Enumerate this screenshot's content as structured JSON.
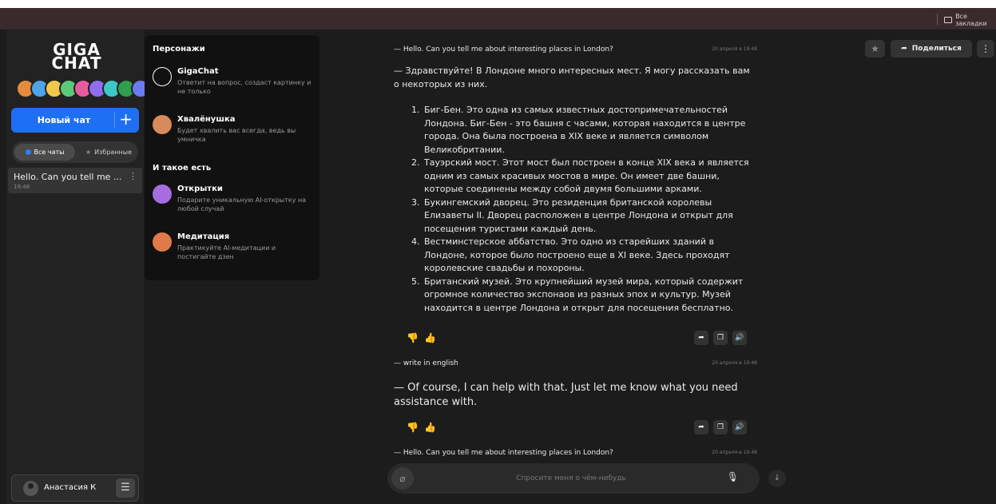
{
  "browser": {
    "bookmarks_label": "Все закладки"
  },
  "sidebar": {
    "logo_line1": "GIGA",
    "logo_line2": "CHAT",
    "new_chat_label": "Новый чат",
    "plus_symbol": "+",
    "filters": {
      "all": "Все чаты",
      "favorites": "Избранные"
    },
    "chats": [
      {
        "title": "Hello. Can you tell me ...",
        "time": "19:48",
        "menu": "⋮"
      }
    ],
    "user": {
      "name": "Анастасия К",
      "menu_icon": "☰"
    }
  },
  "characters": {
    "section1": "Персонажи",
    "section2": "И такое есть",
    "items": [
      {
        "name": "GigaChat",
        "desc": "Ответит на вопрос, создаст картинку и не только",
        "icon": "gigachat-logo-icon",
        "color": "#111111"
      },
      {
        "name": "Хвалёнушка",
        "desc": "Будет хвалить вас всегда, ведь вы умничка",
        "icon": "hvalenushka-avatar-icon",
        "color": "#d98a5c"
      },
      {
        "name": "Открытки",
        "desc": "Подарите уникальную AI-открытку на любой случай",
        "icon": "postcard-star-icon",
        "color": "#a56de0"
      },
      {
        "name": "Медитация",
        "desc": "Практикуйте AI-медитации и постигайте дзен",
        "icon": "meditation-star-icon",
        "color": "#e07a4a"
      }
    ]
  },
  "conversation": {
    "user_q1": "— Hello. Can you tell me about interesting places in London?",
    "user_q1_time": "20 апреля в 19:48",
    "answer1_intro": "— Здравствуйте! В Лондоне много интересных мест. Я могу рассказать вам о некоторых из них.",
    "answer1_items": [
      "Биг-Бен. Это одна из самых известных достопримечательностей Лондона. Биг-Бен - это башня с часами, которая находится в центре города. Она была построена в XIX веке и является символом Великобритании.",
      "Тауэрский мост. Этот мост был построен в конце XIX века и является одним из самых красивых мостов в мире. Он имеет две башни, которые соединены между собой двумя большими арками.",
      "Букингемский дворец. Это резиденция британской королевы Елизаветы II. Дворец расположен в центре Лондона и открыт для посещения туристами каждый день.",
      "Вестминстерское аббатство. Это одно из старейших зданий в Лондоне, которое было построено еще в XI веке. Здесь проходят королевские свадьбы и похороны.",
      "Британский музей. Это крупнейший музей мира, который содержит огромное количество экспонаов из разных эпох и культур. Музей находится в центре Лондона и открыт для посещения бесплатно."
    ],
    "user_q2": "— write in english",
    "user_q2_time": "20 апреля в 19:48",
    "answer2": "— Of course, I can help with that. Just let me know what you need assistance with.",
    "user_q3": "— Hello. Can you tell me about interesting places in London?",
    "user_q3_time": "20 апреля в 19:48",
    "input_placeholder": "Спросите меня о чём-нибудь"
  },
  "header": {
    "share_label": "Поделиться",
    "more_icon": "⋮"
  },
  "colors": {
    "accent": "#1f6ff2",
    "background": "#1c1c1c"
  }
}
